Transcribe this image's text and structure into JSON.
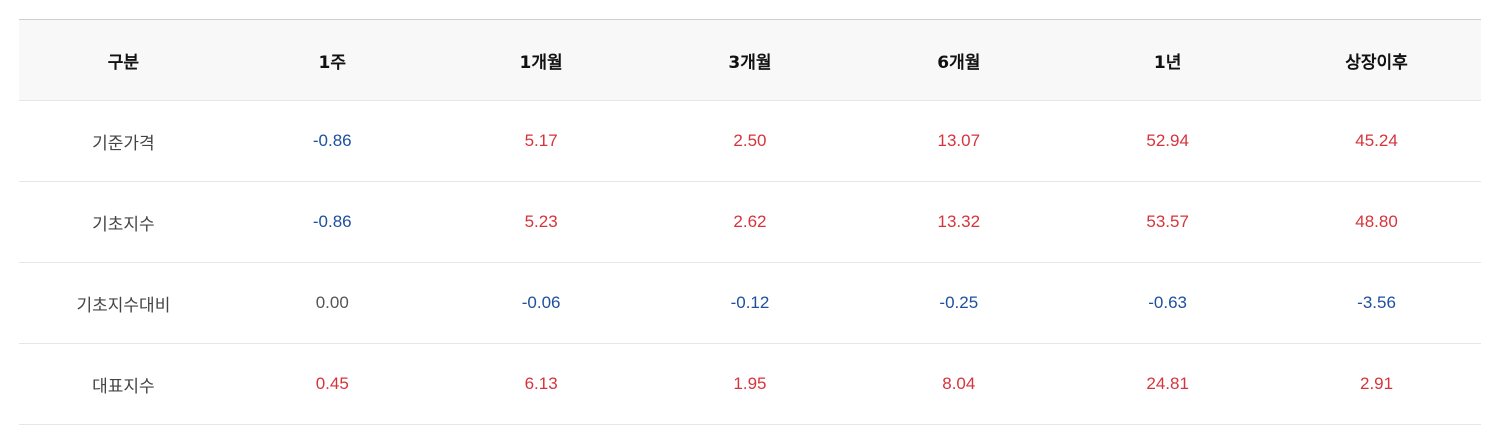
{
  "table": {
    "headers": [
      "구분",
      "1주",
      "1개월",
      "3개월",
      "6개월",
      "1년",
      "상장이후"
    ],
    "rows": [
      {
        "label": "기준가격",
        "values": [
          "-0.86",
          "5.17",
          "2.50",
          "13.07",
          "52.94",
          "45.24"
        ]
      },
      {
        "label": "기초지수",
        "values": [
          "-0.86",
          "5.23",
          "2.62",
          "13.32",
          "53.57",
          "48.80"
        ]
      },
      {
        "label": "기초지수대비",
        "values": [
          "0.00",
          "-0.06",
          "-0.12",
          "-0.25",
          "-0.63",
          "-3.56"
        ]
      },
      {
        "label": "대표지수",
        "values": [
          "0.45",
          "6.13",
          "1.95",
          "8.04",
          "24.81",
          "2.91"
        ]
      }
    ]
  },
  "colors": {
    "positive": "#d6343c",
    "negative": "#1f4fa0",
    "neutral": "#555555",
    "header_bg": "#f8f8f8"
  }
}
